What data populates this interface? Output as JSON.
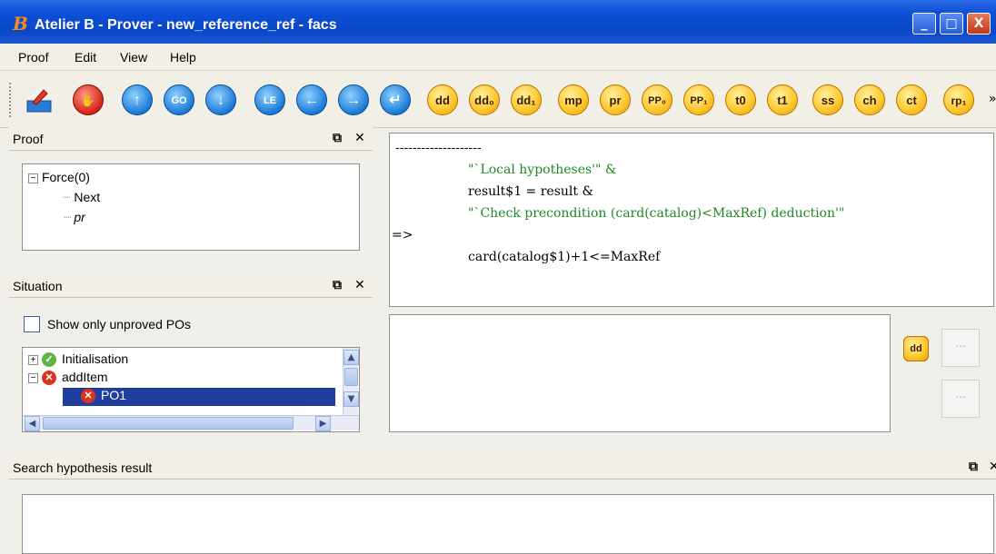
{
  "window": {
    "title": "Atelier B - Prover - new_reference_ref - facs",
    "logo": "B",
    "controls": [
      "_",
      "□",
      "X"
    ]
  },
  "menu": [
    "Proof",
    "Edit",
    "View",
    "Help"
  ],
  "toolbar": {
    "buttons": [
      {
        "icon": "export-icon",
        "label": ""
      },
      {
        "icon": "stop-hand-icon",
        "label": ""
      },
      {
        "icon": "go-up-icon",
        "label": "↑"
      },
      {
        "icon": "goto-icon",
        "label": "GO"
      },
      {
        "icon": "go-down-icon",
        "label": "↓"
      },
      {
        "icon": "go-left-icon",
        "label": "LE"
      },
      {
        "icon": "go-back-icon",
        "label": "←"
      },
      {
        "icon": "go-forward-icon",
        "label": "→"
      },
      {
        "icon": "go-end-icon",
        "label": "↵"
      },
      {
        "icon": "dd-icon",
        "label": "dd"
      },
      {
        "icon": "dd0-icon",
        "label": "dd₀"
      },
      {
        "icon": "dd1-icon",
        "label": "dd₁"
      },
      {
        "icon": "mp-icon",
        "label": "mp"
      },
      {
        "icon": "pr-icon",
        "label": "pr"
      },
      {
        "icon": "pp0-icon",
        "label": "PP₀"
      },
      {
        "icon": "pp1-icon",
        "label": "PP₁"
      },
      {
        "icon": "t0-icon",
        "label": "t0"
      },
      {
        "icon": "t1-icon",
        "label": "t1"
      },
      {
        "icon": "ss-icon",
        "label": "ss"
      },
      {
        "icon": "ch-icon",
        "label": "ch"
      },
      {
        "icon": "ct-icon",
        "label": "ct"
      },
      {
        "icon": "rp1-icon",
        "label": "rp₁"
      }
    ],
    "overflow": "»"
  },
  "proof_panel": {
    "title": "Proof",
    "tree": {
      "root": "Force(0)",
      "children": [
        "Next",
        "pr"
      ]
    }
  },
  "goal_panel": {
    "lines": [
      "--------------------",
      "\"`Local hypotheses'\" &",
      "result$1 = result &",
      "\"`Check precondition (card(catalog)<MaxRef) deduction'\"",
      "=>",
      "card(catalog$1)+1<=MaxRef"
    ]
  },
  "situation_panel": {
    "title": "Situation",
    "checkbox_label": "Show only unproved POs",
    "tree": [
      {
        "label": "Initialisation",
        "status": "proved"
      },
      {
        "label": "addItem",
        "status": "unproved"
      },
      {
        "label": "PO1",
        "status": "unproved",
        "selected": true
      }
    ]
  },
  "command_panel": {
    "side_button": "dd"
  },
  "search_panel": {
    "title": "Search hypothesis result"
  }
}
